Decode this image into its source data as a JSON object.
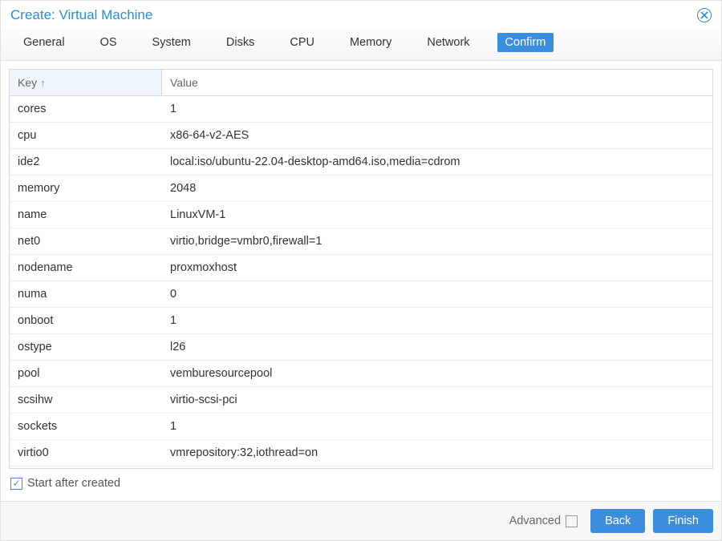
{
  "title": "Create: Virtual Machine",
  "tabs": [
    {
      "label": "General"
    },
    {
      "label": "OS"
    },
    {
      "label": "System"
    },
    {
      "label": "Disks"
    },
    {
      "label": "CPU"
    },
    {
      "label": "Memory"
    },
    {
      "label": "Network"
    },
    {
      "label": "Confirm",
      "active": true
    }
  ],
  "columns": {
    "key": "Key",
    "value": "Value"
  },
  "rows": [
    {
      "key": "cores",
      "value": "1"
    },
    {
      "key": "cpu",
      "value": "x86-64-v2-AES"
    },
    {
      "key": "ide2",
      "value": "local:iso/ubuntu-22.04-desktop-amd64.iso,media=cdrom"
    },
    {
      "key": "memory",
      "value": "2048"
    },
    {
      "key": "name",
      "value": "LinuxVM-1"
    },
    {
      "key": "net0",
      "value": "virtio,bridge=vmbr0,firewall=1"
    },
    {
      "key": "nodename",
      "value": "proxmoxhost"
    },
    {
      "key": "numa",
      "value": "0"
    },
    {
      "key": "onboot",
      "value": "1"
    },
    {
      "key": "ostype",
      "value": "l26"
    },
    {
      "key": "pool",
      "value": "vemburesourcepool"
    },
    {
      "key": "scsihw",
      "value": "virtio-scsi-pci"
    },
    {
      "key": "sockets",
      "value": "1"
    },
    {
      "key": "virtio0",
      "value": "vmrepository:32,iothread=on"
    }
  ],
  "start_after_created": {
    "label": "Start after created",
    "checked": true
  },
  "footer": {
    "advanced_label": "Advanced",
    "advanced_checked": false,
    "back": "Back",
    "finish": "Finish"
  }
}
